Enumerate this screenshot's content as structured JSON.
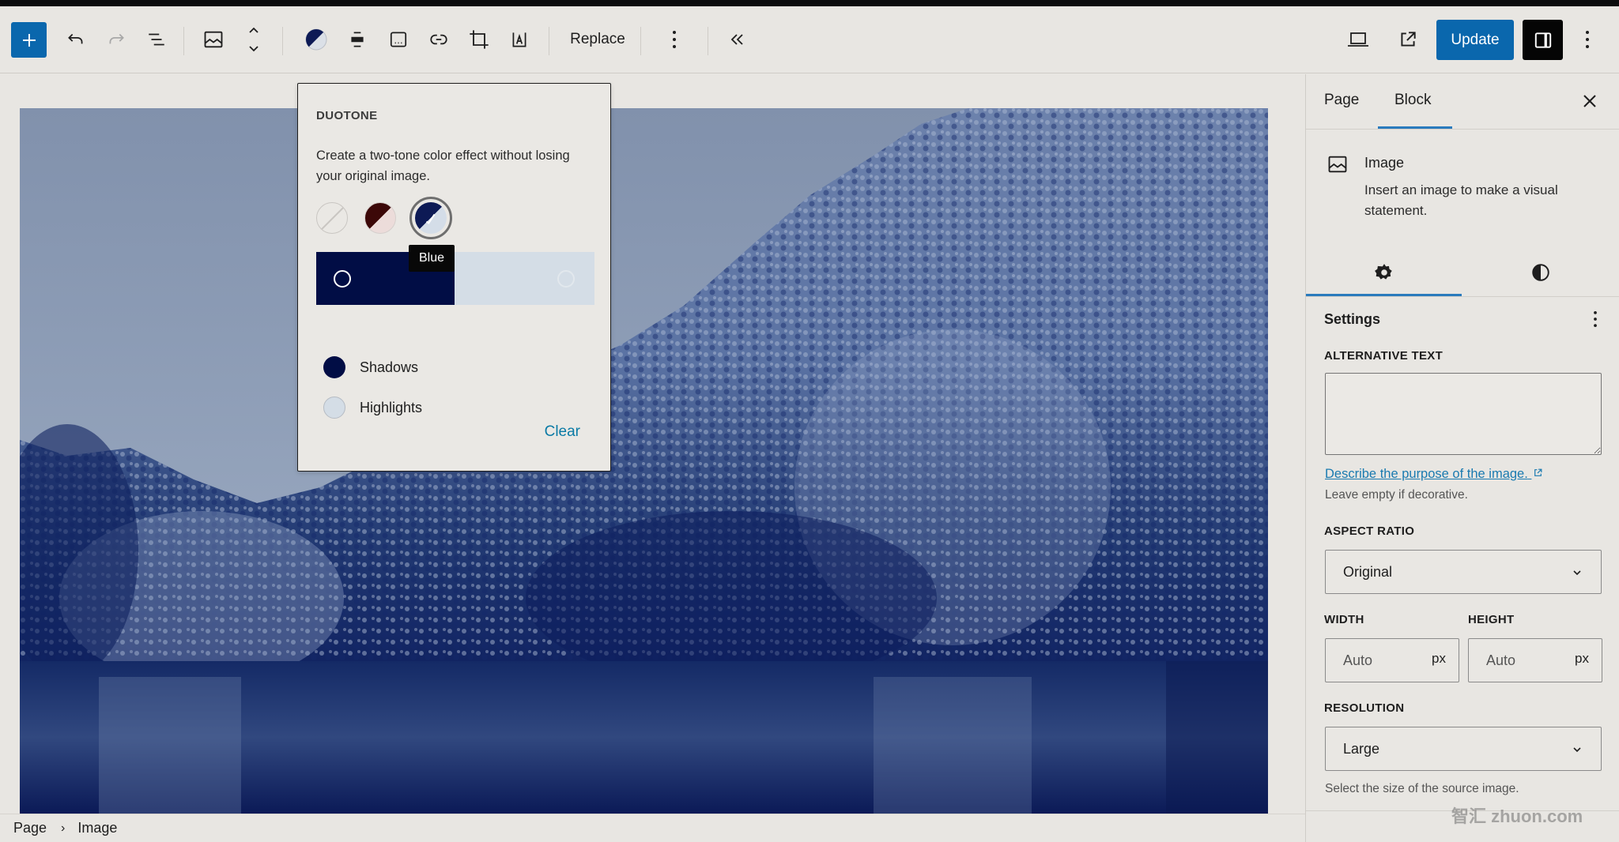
{
  "toolbar": {
    "add_block_label": "+",
    "replace_label": "Replace",
    "update_label": "Update",
    "icons": [
      "plus-icon",
      "undo-icon",
      "redo-icon",
      "list-view-icon",
      "image-icon",
      "move-up-down-icon",
      "duotone-icon",
      "align-icon",
      "caption-icon",
      "link-icon",
      "crop-icon",
      "text-overlay-icon",
      "more-options-icon",
      "collapse-icon",
      "preview-desktop-icon",
      "external-link-icon",
      "sidebar-toggle-icon",
      "options-icon"
    ]
  },
  "duotone": {
    "title": "DUOTONE",
    "description": "Create a two-tone color effect without losing your original image.",
    "presets": [
      {
        "name": "None",
        "shadow": "",
        "highlight": ""
      },
      {
        "name": "Red",
        "shadow": "#3c0808",
        "highlight": "#ecdcda"
      },
      {
        "name": "Blue",
        "shadow": "#0d1a55",
        "highlight": "#d4dde8",
        "selected": true
      }
    ],
    "tooltip": "Blue",
    "shadows_label": "Shadows",
    "highlights_label": "Highlights",
    "shadow_color": "#010d45",
    "highlight_color": "#d4dde6",
    "clear_label": "Clear"
  },
  "breadcrumb": {
    "items": [
      "Page",
      "Image"
    ]
  },
  "sidebar": {
    "tabs": [
      {
        "label": "Page",
        "active": false
      },
      {
        "label": "Block",
        "active": true
      }
    ],
    "block": {
      "name": "Image",
      "description": "Insert an image to make a visual statement."
    },
    "sub_tabs": [
      "settings-gear",
      "styles-contrast"
    ],
    "settings": {
      "heading": "Settings",
      "alt_text_label": "ALTERNATIVE TEXT",
      "alt_text_value": "",
      "alt_link": "Describe the purpose of the image.",
      "alt_help": "Leave empty if decorative.",
      "aspect_ratio_label": "ASPECT RATIO",
      "aspect_ratio_value": "Original",
      "width_label": "WIDTH",
      "width_placeholder": "Auto",
      "width_unit": "px",
      "height_label": "HEIGHT",
      "height_placeholder": "Auto",
      "height_unit": "px",
      "resolution_label": "RESOLUTION",
      "resolution_value": "Large",
      "resolution_help": "Select the size of the source image."
    }
  },
  "colors": {
    "accent": "#0a67ad",
    "link": "#1a7ab0",
    "tab_indicator": "#2a7bbd"
  },
  "watermark": "智汇 zhuon.com"
}
